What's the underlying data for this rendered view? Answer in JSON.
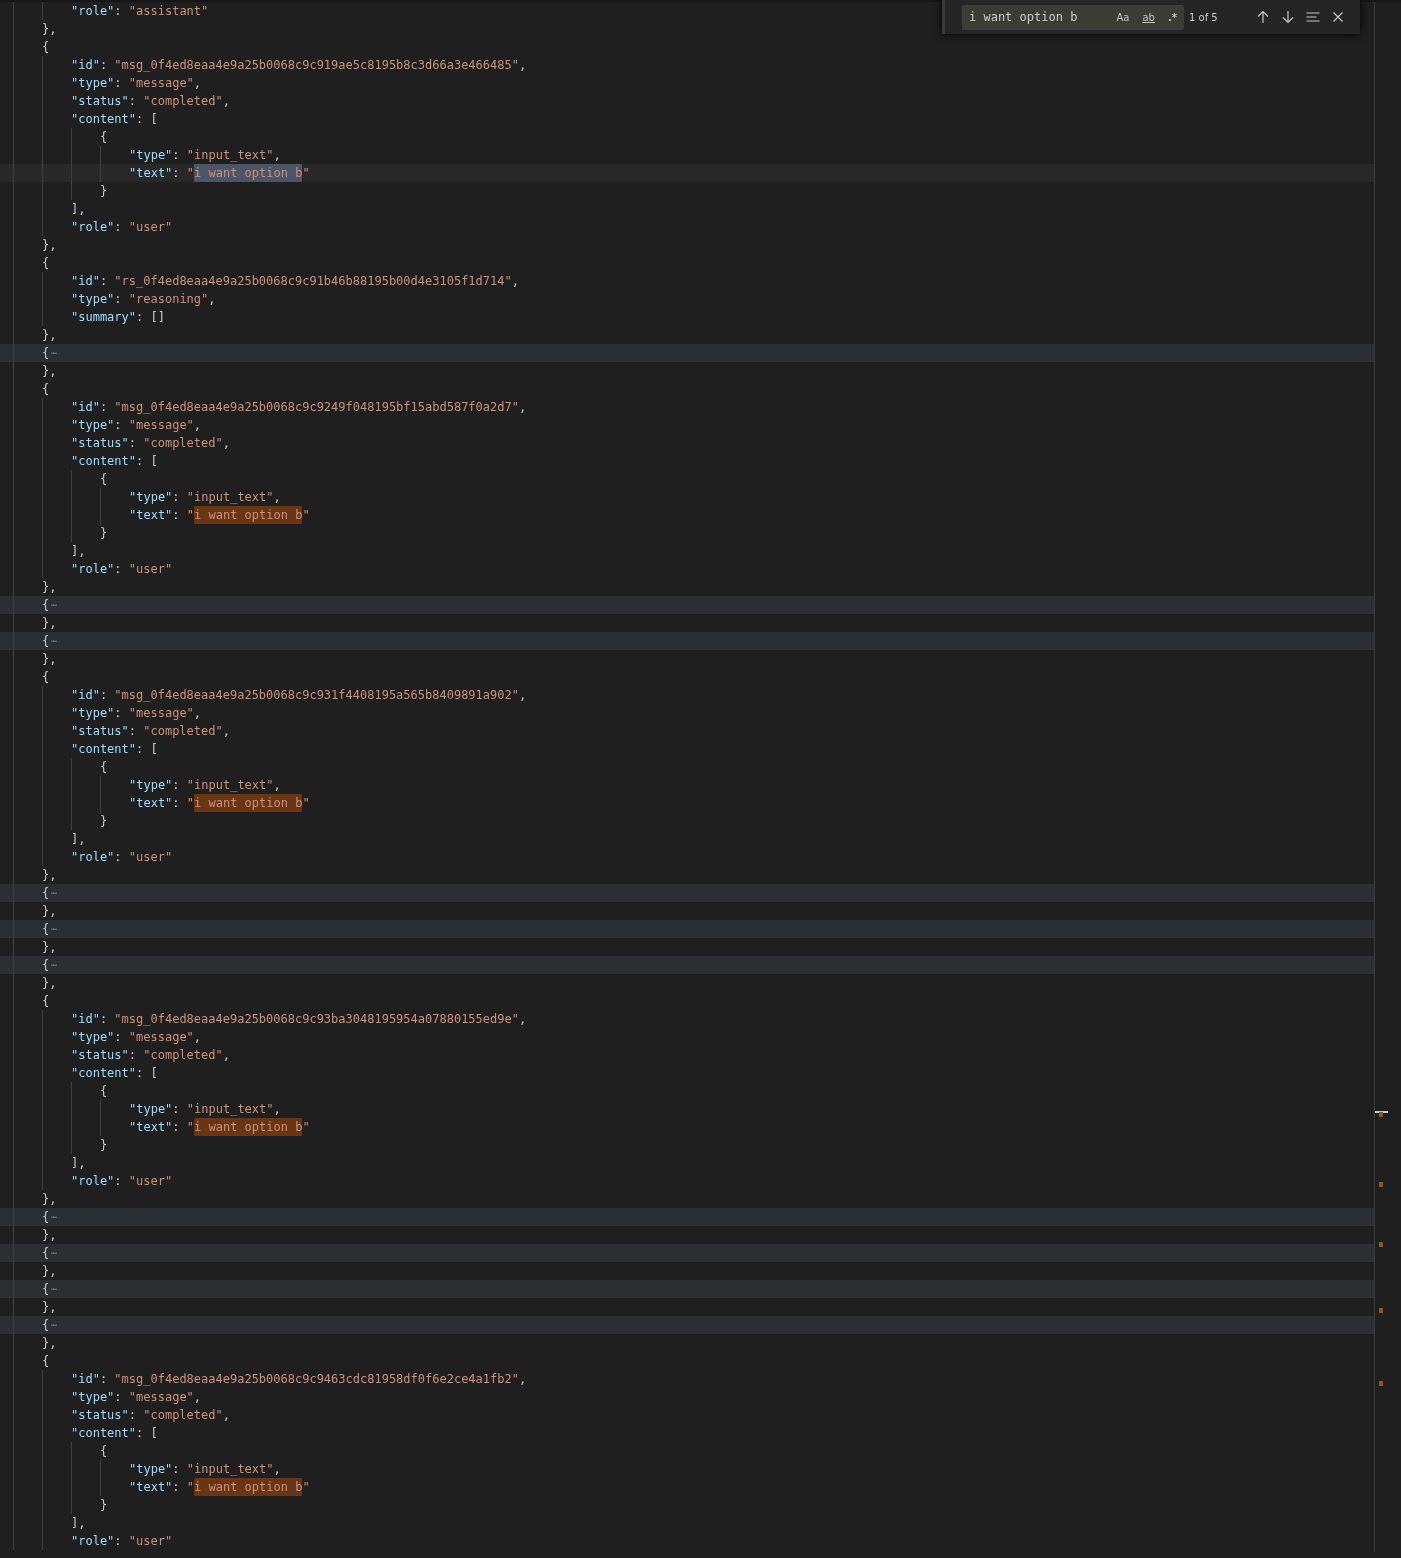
{
  "editor": {
    "lines": [
      {
        "children": [
          {
            "kind": "line",
            "tokens": [
              {
                "kind": "key",
                "text": "\"role\""
              },
              {
                "kind": "punct",
                "text": ": "
              },
              {
                "kind": "string",
                "text": "\"assistant\""
              }
            ]
          }
        ]
      },
      {
        "kind": "line",
        "tokens": [
          {
            "kind": "punct",
            "text": "},"
          }
        ]
      },
      {
        "kind": "line",
        "tokens": [
          {
            "kind": "punct",
            "text": "{"
          }
        ],
        "children": [
          {
            "kind": "line",
            "tokens": [
              {
                "kind": "key",
                "text": "\"id\""
              },
              {
                "kind": "punct",
                "text": ": "
              },
              {
                "kind": "string",
                "text": "\"msg_0f4ed8eaa4e9a25b0068c9c919ae5c8195b8c3d66a3e466485\""
              },
              {
                "kind": "punct",
                "text": ","
              }
            ]
          },
          {
            "kind": "line",
            "tokens": [
              {
                "kind": "key",
                "text": "\"type\""
              },
              {
                "kind": "punct",
                "text": ": "
              },
              {
                "kind": "string",
                "text": "\"message\""
              },
              {
                "kind": "punct",
                "text": ","
              }
            ]
          },
          {
            "kind": "line",
            "tokens": [
              {
                "kind": "key",
                "text": "\"status\""
              },
              {
                "kind": "punct",
                "text": ": "
              },
              {
                "kind": "string",
                "text": "\"completed\""
              },
              {
                "kind": "punct",
                "text": ","
              }
            ]
          },
          {
            "kind": "line",
            "tokens": [
              {
                "kind": "key",
                "text": "\"content\""
              },
              {
                "kind": "punct",
                "text": ": ["
              }
            ],
            "children": [
              {
                "kind": "line",
                "tokens": [
                  {
                    "kind": "punct",
                    "text": "{"
                  }
                ],
                "children": [
                  {
                    "kind": "line",
                    "tokens": [
                      {
                        "kind": "key",
                        "text": "\"type\""
                      },
                      {
                        "kind": "punct",
                        "text": ": "
                      },
                      {
                        "kind": "string",
                        "text": "\"input_text\""
                      },
                      {
                        "kind": "punct",
                        "text": ","
                      }
                    ]
                  },
                  {
                    "kind": "current",
                    "tokens": [
                      {
                        "kind": "key",
                        "text": "\"text\""
                      },
                      {
                        "kind": "punct",
                        "text": ": "
                      },
                      {
                        "kind": "string",
                        "text": "\""
                      },
                      {
                        "kind": "match",
                        "text": "i want option b",
                        "selected": true
                      },
                      {
                        "kind": "string",
                        "text": "\""
                      }
                    ]
                  }
                ]
              },
              {
                "kind": "line",
                "tokens": [
                  {
                    "kind": "punct",
                    "text": "}"
                  }
                ]
              }
            ]
          },
          {
            "kind": "line",
            "tokens": [
              {
                "kind": "punct",
                "text": "],"
              }
            ]
          },
          {
            "kind": "line",
            "tokens": [
              {
                "kind": "key",
                "text": "\"role\""
              },
              {
                "kind": "punct",
                "text": ": "
              },
              {
                "kind": "string",
                "text": "\"user\""
              }
            ]
          }
        ]
      },
      {
        "kind": "line",
        "tokens": [
          {
            "kind": "punct",
            "text": "},"
          }
        ]
      },
      {
        "kind": "line",
        "tokens": [
          {
            "kind": "punct",
            "text": "{"
          }
        ],
        "children": [
          {
            "kind": "line",
            "tokens": [
              {
                "kind": "key",
                "text": "\"id\""
              },
              {
                "kind": "punct",
                "text": ": "
              },
              {
                "kind": "string",
                "text": "\"rs_0f4ed8eaa4e9a25b0068c9c91b46b88195b00d4e3105f1d714\""
              },
              {
                "kind": "punct",
                "text": ","
              }
            ]
          },
          {
            "kind": "line",
            "tokens": [
              {
                "kind": "key",
                "text": "\"type\""
              },
              {
                "kind": "punct",
                "text": ": "
              },
              {
                "kind": "string",
                "text": "\"reasoning\""
              },
              {
                "kind": "punct",
                "text": ","
              }
            ]
          },
          {
            "kind": "line",
            "tokens": [
              {
                "kind": "key",
                "text": "\"summary\""
              },
              {
                "kind": "punct",
                "text": ": []"
              }
            ]
          }
        ]
      },
      {
        "kind": "line",
        "tokens": [
          {
            "kind": "punct",
            "text": "},"
          }
        ]
      },
      {
        "kind": "folded",
        "tokens": [
          {
            "kind": "punct",
            "text": "{"
          },
          {
            "kind": "ellipsis",
            "text": "⋯"
          }
        ]
      },
      {
        "kind": "line",
        "tokens": [
          {
            "kind": "punct",
            "text": "},"
          }
        ]
      },
      {
        "kind": "line",
        "tokens": [
          {
            "kind": "punct",
            "text": "{"
          }
        ],
        "children": [
          {
            "kind": "line",
            "tokens": [
              {
                "kind": "key",
                "text": "\"id\""
              },
              {
                "kind": "punct",
                "text": ": "
              },
              {
                "kind": "string",
                "text": "\"msg_0f4ed8eaa4e9a25b0068c9c9249f048195bf15abd587f0a2d7\""
              },
              {
                "kind": "punct",
                "text": ","
              }
            ]
          },
          {
            "kind": "line",
            "tokens": [
              {
                "kind": "key",
                "text": "\"type\""
              },
              {
                "kind": "punct",
                "text": ": "
              },
              {
                "kind": "string",
                "text": "\"message\""
              },
              {
                "kind": "punct",
                "text": ","
              }
            ]
          },
          {
            "kind": "line",
            "tokens": [
              {
                "kind": "key",
                "text": "\"status\""
              },
              {
                "kind": "punct",
                "text": ": "
              },
              {
                "kind": "string",
                "text": "\"completed\""
              },
              {
                "kind": "punct",
                "text": ","
              }
            ]
          },
          {
            "kind": "line",
            "tokens": [
              {
                "kind": "key",
                "text": "\"content\""
              },
              {
                "kind": "punct",
                "text": ": ["
              }
            ],
            "children": [
              {
                "kind": "line",
                "tokens": [
                  {
                    "kind": "punct",
                    "text": "{"
                  }
                ],
                "children": [
                  {
                    "kind": "line",
                    "tokens": [
                      {
                        "kind": "key",
                        "text": "\"type\""
                      },
                      {
                        "kind": "punct",
                        "text": ": "
                      },
                      {
                        "kind": "string",
                        "text": "\"input_text\""
                      },
                      {
                        "kind": "punct",
                        "text": ","
                      }
                    ]
                  },
                  {
                    "kind": "line",
                    "tokens": [
                      {
                        "kind": "key",
                        "text": "\"text\""
                      },
                      {
                        "kind": "punct",
                        "text": ": "
                      },
                      {
                        "kind": "string",
                        "text": "\""
                      },
                      {
                        "kind": "match",
                        "text": "i want option b",
                        "selected": false
                      },
                      {
                        "kind": "string",
                        "text": "\""
                      }
                    ]
                  }
                ]
              },
              {
                "kind": "line",
                "tokens": [
                  {
                    "kind": "punct",
                    "text": "}"
                  }
                ]
              }
            ]
          },
          {
            "kind": "line",
            "tokens": [
              {
                "kind": "punct",
                "text": "],"
              }
            ]
          },
          {
            "kind": "line",
            "tokens": [
              {
                "kind": "key",
                "text": "\"role\""
              },
              {
                "kind": "punct",
                "text": ": "
              },
              {
                "kind": "string",
                "text": "\"user\""
              }
            ]
          }
        ]
      },
      {
        "kind": "line",
        "tokens": [
          {
            "kind": "punct",
            "text": "},"
          }
        ]
      },
      {
        "kind": "folded",
        "tokens": [
          {
            "kind": "punct",
            "text": "{"
          },
          {
            "kind": "ellipsis",
            "text": "⋯"
          }
        ]
      },
      {
        "kind": "line",
        "tokens": [
          {
            "kind": "punct",
            "text": "},"
          }
        ]
      },
      {
        "kind": "folded",
        "tokens": [
          {
            "kind": "punct",
            "text": "{"
          },
          {
            "kind": "ellipsis",
            "text": "⋯"
          }
        ]
      },
      {
        "kind": "line",
        "tokens": [
          {
            "kind": "punct",
            "text": "},"
          }
        ]
      },
      {
        "kind": "line",
        "tokens": [
          {
            "kind": "punct",
            "text": "{"
          }
        ],
        "children": [
          {
            "kind": "line",
            "tokens": [
              {
                "kind": "key",
                "text": "\"id\""
              },
              {
                "kind": "punct",
                "text": ": "
              },
              {
                "kind": "string",
                "text": "\"msg_0f4ed8eaa4e9a25b0068c9c931f4408195a565b8409891a902\""
              },
              {
                "kind": "punct",
                "text": ","
              }
            ]
          },
          {
            "kind": "line",
            "tokens": [
              {
                "kind": "key",
                "text": "\"type\""
              },
              {
                "kind": "punct",
                "text": ": "
              },
              {
                "kind": "string",
                "text": "\"message\""
              },
              {
                "kind": "punct",
                "text": ","
              }
            ]
          },
          {
            "kind": "line",
            "tokens": [
              {
                "kind": "key",
                "text": "\"status\""
              },
              {
                "kind": "punct",
                "text": ": "
              },
              {
                "kind": "string",
                "text": "\"completed\""
              },
              {
                "kind": "punct",
                "text": ","
              }
            ]
          },
          {
            "kind": "line",
            "tokens": [
              {
                "kind": "key",
                "text": "\"content\""
              },
              {
                "kind": "punct",
                "text": ": ["
              }
            ],
            "children": [
              {
                "kind": "line",
                "tokens": [
                  {
                    "kind": "punct",
                    "text": "{"
                  }
                ],
                "children": [
                  {
                    "kind": "line",
                    "tokens": [
                      {
                        "kind": "key",
                        "text": "\"type\""
                      },
                      {
                        "kind": "punct",
                        "text": ": "
                      },
                      {
                        "kind": "string",
                        "text": "\"input_text\""
                      },
                      {
                        "kind": "punct",
                        "text": ","
                      }
                    ]
                  },
                  {
                    "kind": "line",
                    "tokens": [
                      {
                        "kind": "key",
                        "text": "\"text\""
                      },
                      {
                        "kind": "punct",
                        "text": ": "
                      },
                      {
                        "kind": "string",
                        "text": "\""
                      },
                      {
                        "kind": "match",
                        "text": "i want option b",
                        "selected": false
                      },
                      {
                        "kind": "string",
                        "text": "\""
                      }
                    ]
                  }
                ]
              },
              {
                "kind": "line",
                "tokens": [
                  {
                    "kind": "punct",
                    "text": "}"
                  }
                ]
              }
            ]
          },
          {
            "kind": "line",
            "tokens": [
              {
                "kind": "punct",
                "text": "],"
              }
            ]
          },
          {
            "kind": "line",
            "tokens": [
              {
                "kind": "key",
                "text": "\"role\""
              },
              {
                "kind": "punct",
                "text": ": "
              },
              {
                "kind": "string",
                "text": "\"user\""
              }
            ]
          }
        ]
      },
      {
        "kind": "line",
        "tokens": [
          {
            "kind": "punct",
            "text": "},"
          }
        ]
      },
      {
        "kind": "folded",
        "tokens": [
          {
            "kind": "punct",
            "text": "{"
          },
          {
            "kind": "ellipsis",
            "text": "⋯"
          }
        ]
      },
      {
        "kind": "line",
        "tokens": [
          {
            "kind": "punct",
            "text": "},"
          }
        ]
      },
      {
        "kind": "folded",
        "tokens": [
          {
            "kind": "punct",
            "text": "{"
          },
          {
            "kind": "ellipsis",
            "text": "⋯"
          }
        ]
      },
      {
        "kind": "line",
        "tokens": [
          {
            "kind": "punct",
            "text": "},"
          }
        ]
      },
      {
        "kind": "folded",
        "tokens": [
          {
            "kind": "punct",
            "text": "{"
          },
          {
            "kind": "ellipsis",
            "text": "⋯"
          }
        ]
      },
      {
        "kind": "line",
        "tokens": [
          {
            "kind": "punct",
            "text": "},"
          }
        ]
      },
      {
        "kind": "line",
        "tokens": [
          {
            "kind": "punct",
            "text": "{"
          }
        ],
        "children": [
          {
            "kind": "line",
            "tokens": [
              {
                "kind": "key",
                "text": "\"id\""
              },
              {
                "kind": "punct",
                "text": ": "
              },
              {
                "kind": "string",
                "text": "\"msg_0f4ed8eaa4e9a25b0068c9c93ba3048195954a07880155ed9e\""
              },
              {
                "kind": "punct",
                "text": ","
              }
            ]
          },
          {
            "kind": "line",
            "tokens": [
              {
                "kind": "key",
                "text": "\"type\""
              },
              {
                "kind": "punct",
                "text": ": "
              },
              {
                "kind": "string",
                "text": "\"message\""
              },
              {
                "kind": "punct",
                "text": ","
              }
            ]
          },
          {
            "kind": "line",
            "tokens": [
              {
                "kind": "key",
                "text": "\"status\""
              },
              {
                "kind": "punct",
                "text": ": "
              },
              {
                "kind": "string",
                "text": "\"completed\""
              },
              {
                "kind": "punct",
                "text": ","
              }
            ]
          },
          {
            "kind": "line",
            "tokens": [
              {
                "kind": "key",
                "text": "\"content\""
              },
              {
                "kind": "punct",
                "text": ": ["
              }
            ],
            "children": [
              {
                "kind": "line",
                "tokens": [
                  {
                    "kind": "punct",
                    "text": "{"
                  }
                ],
                "children": [
                  {
                    "kind": "line",
                    "tokens": [
                      {
                        "kind": "key",
                        "text": "\"type\""
                      },
                      {
                        "kind": "punct",
                        "text": ": "
                      },
                      {
                        "kind": "string",
                        "text": "\"input_text\""
                      },
                      {
                        "kind": "punct",
                        "text": ","
                      }
                    ]
                  },
                  {
                    "kind": "line",
                    "tokens": [
                      {
                        "kind": "key",
                        "text": "\"text\""
                      },
                      {
                        "kind": "punct",
                        "text": ": "
                      },
                      {
                        "kind": "string",
                        "text": "\""
                      },
                      {
                        "kind": "match",
                        "text": "i want option b",
                        "selected": false
                      },
                      {
                        "kind": "string",
                        "text": "\""
                      }
                    ]
                  }
                ]
              },
              {
                "kind": "line",
                "tokens": [
                  {
                    "kind": "punct",
                    "text": "}"
                  }
                ]
              }
            ]
          },
          {
            "kind": "line",
            "tokens": [
              {
                "kind": "punct",
                "text": "],"
              }
            ]
          },
          {
            "kind": "line",
            "tokens": [
              {
                "kind": "key",
                "text": "\"role\""
              },
              {
                "kind": "punct",
                "text": ": "
              },
              {
                "kind": "string",
                "text": "\"user\""
              }
            ]
          }
        ]
      },
      {
        "kind": "line",
        "tokens": [
          {
            "kind": "punct",
            "text": "},"
          }
        ]
      },
      {
        "kind": "folded",
        "tokens": [
          {
            "kind": "punct",
            "text": "{"
          },
          {
            "kind": "ellipsis",
            "text": "⋯"
          }
        ]
      },
      {
        "kind": "line",
        "tokens": [
          {
            "kind": "punct",
            "text": "},"
          }
        ]
      },
      {
        "kind": "folded",
        "tokens": [
          {
            "kind": "punct",
            "text": "{"
          },
          {
            "kind": "ellipsis",
            "text": "⋯"
          }
        ]
      },
      {
        "kind": "line",
        "tokens": [
          {
            "kind": "punct",
            "text": "},"
          }
        ]
      },
      {
        "kind": "folded",
        "tokens": [
          {
            "kind": "punct",
            "text": "{"
          },
          {
            "kind": "ellipsis",
            "text": "⋯"
          }
        ]
      },
      {
        "kind": "line",
        "tokens": [
          {
            "kind": "punct",
            "text": "},"
          }
        ]
      },
      {
        "kind": "folded",
        "tokens": [
          {
            "kind": "punct",
            "text": "{"
          },
          {
            "kind": "ellipsis",
            "text": "⋯"
          }
        ]
      },
      {
        "kind": "line",
        "tokens": [
          {
            "kind": "punct",
            "text": "},"
          }
        ]
      },
      {
        "kind": "line",
        "tokens": [
          {
            "kind": "punct",
            "text": "{"
          }
        ],
        "children": [
          {
            "kind": "line",
            "tokens": [
              {
                "kind": "key",
                "text": "\"id\""
              },
              {
                "kind": "punct",
                "text": ": "
              },
              {
                "kind": "string",
                "text": "\"msg_0f4ed8eaa4e9a25b0068c9c9463cdc81958df0f6e2ce4a1fb2\""
              },
              {
                "kind": "punct",
                "text": ","
              }
            ]
          },
          {
            "kind": "line",
            "tokens": [
              {
                "kind": "key",
                "text": "\"type\""
              },
              {
                "kind": "punct",
                "text": ": "
              },
              {
                "kind": "string",
                "text": "\"message\""
              },
              {
                "kind": "punct",
                "text": ","
              }
            ]
          },
          {
            "kind": "line",
            "tokens": [
              {
                "kind": "key",
                "text": "\"status\""
              },
              {
                "kind": "punct",
                "text": ": "
              },
              {
                "kind": "string",
                "text": "\"completed\""
              },
              {
                "kind": "punct",
                "text": ","
              }
            ]
          },
          {
            "kind": "line",
            "tokens": [
              {
                "kind": "key",
                "text": "\"content\""
              },
              {
                "kind": "punct",
                "text": ": ["
              }
            ],
            "children": [
              {
                "kind": "line",
                "tokens": [
                  {
                    "kind": "punct",
                    "text": "{"
                  }
                ],
                "children": [
                  {
                    "kind": "line",
                    "tokens": [
                      {
                        "kind": "key",
                        "text": "\"type\""
                      },
                      {
                        "kind": "punct",
                        "text": ": "
                      },
                      {
                        "kind": "string",
                        "text": "\"input_text\""
                      },
                      {
                        "kind": "punct",
                        "text": ","
                      }
                    ]
                  },
                  {
                    "kind": "line",
                    "tokens": [
                      {
                        "kind": "key",
                        "text": "\"text\""
                      },
                      {
                        "kind": "punct",
                        "text": ": "
                      },
                      {
                        "kind": "string",
                        "text": "\""
                      },
                      {
                        "kind": "match",
                        "text": "i want option b",
                        "selected": false
                      },
                      {
                        "kind": "string",
                        "text": "\""
                      }
                    ]
                  }
                ]
              },
              {
                "kind": "line",
                "tokens": [
                  {
                    "kind": "punct",
                    "text": "}"
                  }
                ]
              }
            ]
          },
          {
            "kind": "line",
            "tokens": [
              {
                "kind": "punct",
                "text": "],"
              }
            ]
          },
          {
            "kind": "line",
            "tokens": [
              {
                "kind": "key",
                "text": "\"role\""
              },
              {
                "kind": "punct",
                "text": ": "
              },
              {
                "kind": "string",
                "text": "\"user\""
              }
            ]
          }
        ]
      }
    ]
  },
  "find_widget": {
    "value": "i want option b",
    "toggles": [
      {
        "kind": "case",
        "label": "Aa",
        "on": false
      },
      {
        "kind": "word",
        "label": "ab",
        "on": false
      },
      {
        "kind": "regex",
        "label": ".*",
        "on": false
      }
    ],
    "count": "1 of 5"
  }
}
